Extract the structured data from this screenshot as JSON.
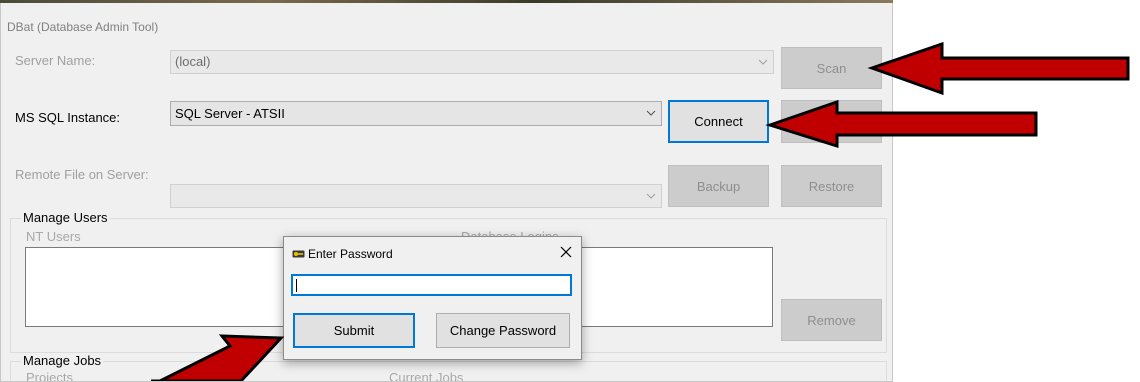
{
  "window": {
    "title": "DBat (Database Admin Tool)"
  },
  "server": {
    "label": "Server Name:",
    "value": "(local)",
    "scan_label": "Scan"
  },
  "instance": {
    "label": "MS SQL Instance:",
    "value": "SQL Server - ATSII",
    "connect_label": "Connect"
  },
  "remote": {
    "label": "Remote File on Server:",
    "value": "",
    "backup_label": "Backup",
    "restore_label": "Restore"
  },
  "manage_users": {
    "title": "Manage Users",
    "nt_users_label": "NT Users",
    "database_logins_label": "Database Logins",
    "remove_label": "Remove"
  },
  "manage_jobs": {
    "title": "Manage Jobs",
    "projects_label": "Projects",
    "current_jobs_label": "Current Jobs"
  },
  "dialog": {
    "title": "Enter Password",
    "password_value": "",
    "submit_label": "Submit",
    "change_password_label": "Change Password"
  },
  "colors": {
    "accent": "#0078d7",
    "arrow_fill": "#c00000",
    "arrow_outline": "#000000"
  },
  "icons": {
    "dialog": "key-icon",
    "close": "close-icon",
    "dropdown": "chevron-down-icon"
  }
}
